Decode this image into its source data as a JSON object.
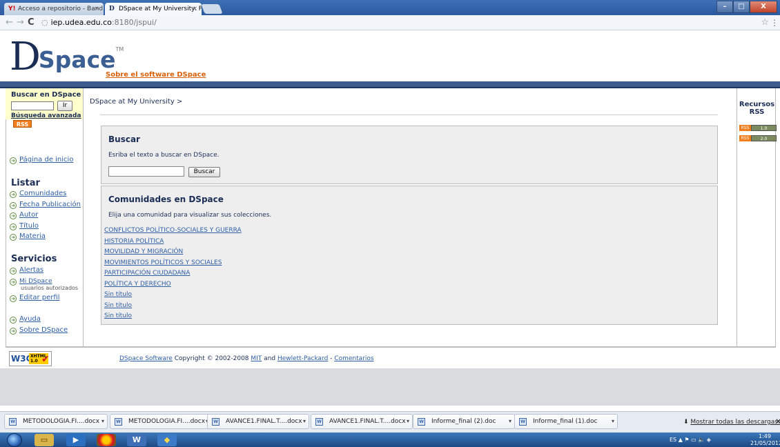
{
  "browser": {
    "tabs": [
      {
        "label": "Acceso a repositorio - Band",
        "favicon": "Y!",
        "close": "×"
      },
      {
        "label": "DSpace at My University: Pá",
        "favicon": "D",
        "close": "×"
      }
    ],
    "url_host": "iep.udea.edu.co",
    "url_path": ":8180/jspui/",
    "window_controls": {
      "minimize": "–",
      "maximize": "□",
      "close": "X"
    }
  },
  "header": {
    "logo_d": "D",
    "logo_space": "Space",
    "logo_tm": "TM",
    "about_link": "Sobre el software DSpace"
  },
  "sidebar": {
    "search_title": "Buscar en DSpace",
    "go_button": "Ir",
    "advanced_search": "Búsqueda avanzada",
    "home": "Página de inicio",
    "browse_title": "Listar",
    "browse_items": [
      "Comunidades",
      "Fecha Publicación",
      "Autor",
      "Título",
      "Materia"
    ],
    "services_title": "Servicios",
    "alerts": "Alertas",
    "mydspace": "Mi DSpace",
    "mydspace_sub": "usuarios autorizados",
    "edit_profile": "Editar perfil",
    "help": "Ayuda",
    "about": "Sobre DSpace"
  },
  "right_sidebar": {
    "title_line1": "Recursos",
    "title_line2": "RSS",
    "rss_badges": [
      {
        "left": "RSS",
        "right": "1.0"
      },
      {
        "left": "RSS",
        "right": "2.0"
      }
    ],
    "rss_main": "RSS"
  },
  "main": {
    "breadcrumb": "DSpace at My University >",
    "search_panel": {
      "title": "Buscar",
      "text": "Esriba el texto a buscar en DSpace.",
      "button": "Buscar"
    },
    "communities_panel": {
      "title": "Comunidades en DSpace",
      "text": "Elija una comunidad para visualizar sus colecciones.",
      "items": [
        "CONFLICTOS POLÍTICO-SOCIALES Y GUERRA",
        "HISTORIA POLÍTICA",
        "MOVILIDAD Y MIGRACIÓN",
        "MOVIMIENTOS POLÍTICOS Y SOCIALES",
        "PARTICIPACIÓN CIUDADANA",
        "POLÍTICA Y DERECHO",
        "Sin título",
        "Sin título",
        "Sin título"
      ]
    }
  },
  "footer": {
    "w3c": "W3C",
    "xhtml": "XHTML",
    "xhtml_version": "1.0",
    "dspace_software": "DSpace Software",
    "copyright": " Copyright © 2002-2008 ",
    "mit": "MIT",
    "and": " and ",
    "hp": "Hewlett-Packard",
    "dash": " - ",
    "comments": "Comentarios"
  },
  "downloads": {
    "items": [
      "METODOLOGIA.FI....docx",
      "METODOLOGIA.FI....docx",
      "AVANCE1.FINAL.T....docx",
      "AVANCE1.FINAL.T....docx",
      "Informe_final (2).doc",
      "Informe_final (1).doc"
    ],
    "show_all": "Mostrar todas las descargas...",
    "close": "×"
  },
  "taskbar": {
    "lang": "ES",
    "time": "1:49",
    "date": "21/05/2012"
  }
}
